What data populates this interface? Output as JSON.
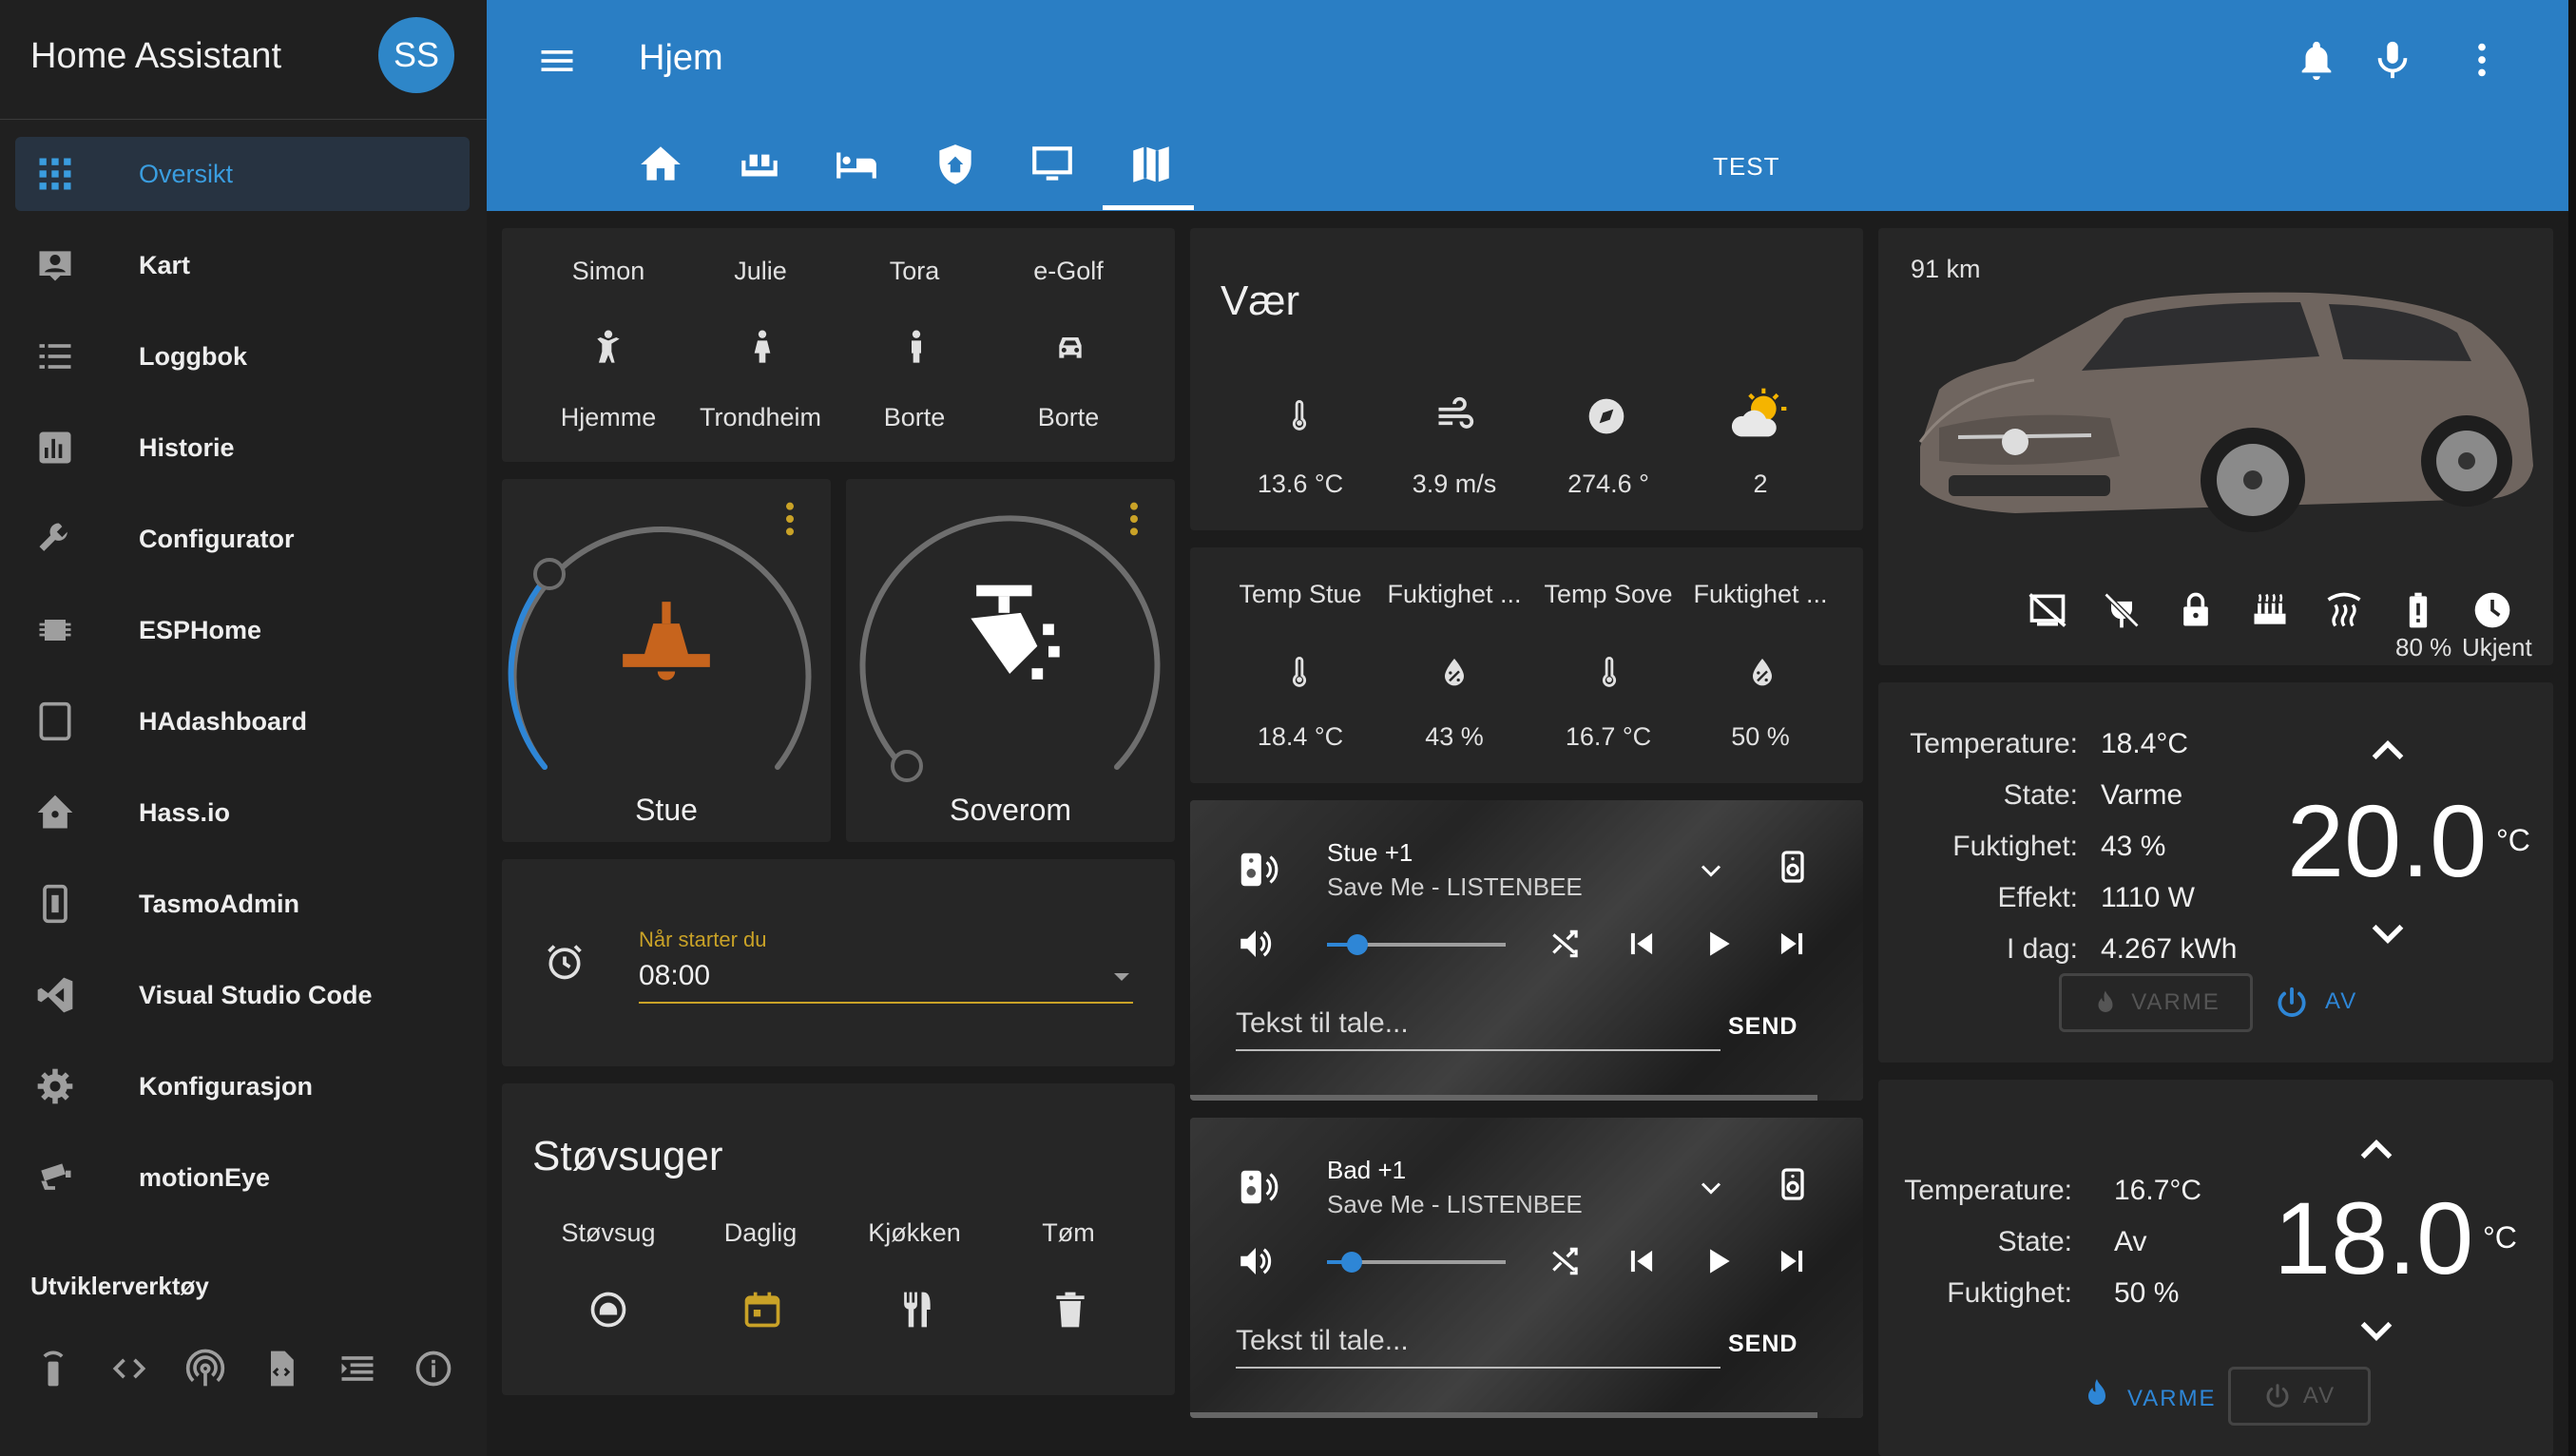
{
  "app": {
    "title": "Home Assistant",
    "avatar": "SS"
  },
  "sidebar": {
    "items": [
      {
        "label": "Oversikt",
        "icon": "grid-icon"
      },
      {
        "label": "Kart",
        "icon": "account-box-icon"
      },
      {
        "label": "Loggbok",
        "icon": "list-icon"
      },
      {
        "label": "Historie",
        "icon": "chart-icon"
      },
      {
        "label": "Configurator",
        "icon": "wrench-icon"
      },
      {
        "label": "ESPHome",
        "icon": "chip-icon"
      },
      {
        "label": "HAdashboard",
        "icon": "tablet-icon"
      },
      {
        "label": "Hass.io",
        "icon": "home-assistant-icon"
      },
      {
        "label": "TasmoAdmin",
        "icon": "switch-icon"
      },
      {
        "label": "Visual Studio Code",
        "icon": "vscode-icon"
      },
      {
        "label": "Konfigurasjon",
        "icon": "gear-icon"
      },
      {
        "label": "motionEye",
        "icon": "cctv-icon"
      }
    ],
    "dev_title": "Utviklerverktøy"
  },
  "header": {
    "title": "Hjem",
    "tabs": [
      "home",
      "sofa",
      "bed",
      "shield-home",
      "monitor",
      "map"
    ],
    "tab_text": "TEST"
  },
  "persons": [
    {
      "name": "Simon",
      "state": "Hjemme",
      "icon": "person-home-icon"
    },
    {
      "name": "Julie",
      "state": "Trondheim",
      "icon": "person-icon"
    },
    {
      "name": "Tora",
      "state": "Borte",
      "icon": "person-icon"
    },
    {
      "name": "e-Golf",
      "state": "Borte",
      "icon": "car-icon"
    }
  ],
  "lights": [
    {
      "name": "Stue",
      "brightness": 0.25
    },
    {
      "name": "Soverom",
      "brightness": 0
    }
  ],
  "alarm": {
    "label": "Når starter du",
    "value": "08:00"
  },
  "vacuum": {
    "title": "Støvsuger",
    "buttons": [
      "Støvsug",
      "Daglig",
      "Kjøkken",
      "Tøm"
    ]
  },
  "weather": {
    "title": "Vær",
    "items": [
      {
        "value": "13.6 °C",
        "icon": "thermometer-icon"
      },
      {
        "value": "3.9 m/s",
        "icon": "wind-icon"
      },
      {
        "value": "274.6 °",
        "icon": "compass-icon"
      },
      {
        "value": "2",
        "icon": "partly-cloudy-icon"
      }
    ]
  },
  "sensors": [
    {
      "name": "Temp Stue",
      "value": "18.4 °C"
    },
    {
      "name": "Fuktighet ...",
      "value": "43 %"
    },
    {
      "name": "Temp Sove",
      "value": "16.7 °C"
    },
    {
      "name": "Fuktighet ...",
      "value": "50 %"
    }
  ],
  "players": [
    {
      "name": "Stue +1",
      "track": "Save Me - LISTENBEE",
      "tts": "Tekst til tale...",
      "send": "SEND",
      "volume": 0.17
    },
    {
      "name": "Bad +1",
      "track": "Save Me - LISTENBEE",
      "tts": "Tekst til tale...",
      "send": "SEND",
      "volume": 0.14
    }
  ],
  "car": {
    "range": "91 km",
    "battery": "80 %",
    "status": "Ukjent"
  },
  "thermostats": [
    {
      "rows": [
        [
          "Temperature:",
          "18.4°C"
        ],
        [
          "State:",
          "Varme"
        ],
        [
          "Fuktighet:",
          "43 %"
        ],
        [
          "Effekt:",
          "1110 W"
        ],
        [
          "I dag:",
          "4.267 kWh"
        ]
      ],
      "setpoint": "20.0",
      "unit": "°C",
      "heat": "VARME",
      "off": "AV"
    },
    {
      "rows": [
        [
          "Temperature:",
          "16.7°C"
        ],
        [
          "State:",
          "Av"
        ],
        [
          "Fuktighet:",
          "50 %"
        ]
      ],
      "setpoint": "18.0",
      "unit": "°C",
      "heat": "VARME",
      "off": "AV"
    }
  ],
  "colors": {
    "accent": "#2a7ec4",
    "light_on": "#c7641d",
    "active_blue": "#2e86d6",
    "underline": "#c9a227"
  }
}
